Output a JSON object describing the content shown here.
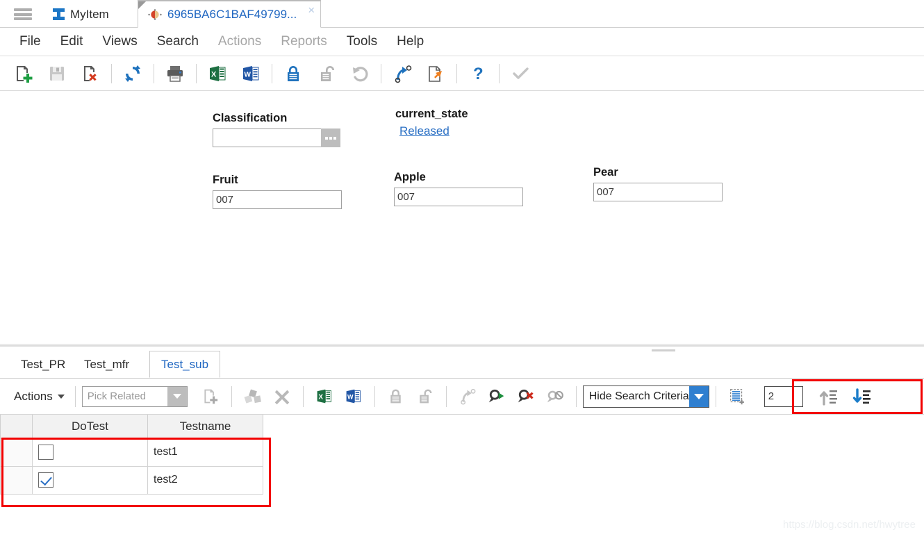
{
  "window": {
    "menu_icon": "hamburger-icon"
  },
  "tabs": [
    {
      "label": "MyItem",
      "icon": "ibeam-icon",
      "active": false
    },
    {
      "label": "6965BA6C1BAF49799...",
      "icon": "sphere-icon",
      "active": true,
      "close": "×"
    }
  ],
  "menubar": [
    {
      "label": "File",
      "disabled": false
    },
    {
      "label": "Edit",
      "disabled": false
    },
    {
      "label": "Views",
      "disabled": false
    },
    {
      "label": "Search",
      "disabled": false
    },
    {
      "label": "Actions",
      "disabled": true
    },
    {
      "label": "Reports",
      "disabled": true
    },
    {
      "label": "Tools",
      "disabled": false
    },
    {
      "label": "Help",
      "disabled": false
    }
  ],
  "toolbar": {
    "buttons": [
      {
        "name": "new-document-icon",
        "enabled": true
      },
      {
        "name": "save-icon",
        "enabled": false
      },
      {
        "name": "delete-document-icon",
        "enabled": true
      },
      {
        "name": "refresh-icon",
        "enabled": true
      },
      {
        "name": "print-icon",
        "enabled": true
      },
      {
        "name": "export-excel-icon",
        "enabled": true
      },
      {
        "name": "export-word-icon",
        "enabled": true
      },
      {
        "name": "lock-icon",
        "enabled": true
      },
      {
        "name": "unlock-icon",
        "enabled": false
      },
      {
        "name": "undo-icon",
        "enabled": false
      },
      {
        "name": "promote-icon",
        "enabled": true
      },
      {
        "name": "copy-to-icon",
        "enabled": true
      },
      {
        "name": "help-icon",
        "enabled": true
      },
      {
        "name": "check-icon",
        "enabled": false
      }
    ]
  },
  "form": {
    "classification": {
      "label": "Classification",
      "value": "",
      "ellipsis": "..."
    },
    "current_state": {
      "label": "current_state",
      "value": "Released"
    },
    "fruit": {
      "label": "Fruit",
      "value": "007"
    },
    "apple": {
      "label": "Apple",
      "value": "007"
    },
    "pear": {
      "label": "Pear",
      "value": "007"
    }
  },
  "subtabs": [
    {
      "label": "Test_PR",
      "active": false
    },
    {
      "label": "Test_mfr",
      "active": false
    },
    {
      "label": "Test_sub",
      "active": true
    }
  ],
  "subtoolbar": {
    "actions_label": "Actions",
    "pick_related_value": "Pick Related",
    "hide_search_label": "Hide Search Criteria",
    "page_size_value": "2",
    "buttons": [
      {
        "name": "add-row-icon",
        "enabled": false
      },
      {
        "name": "structure-browser-icon",
        "enabled": false
      },
      {
        "name": "remove-icon",
        "enabled": false
      },
      {
        "name": "export-excel-icon",
        "enabled": true
      },
      {
        "name": "export-word-icon",
        "enabled": true
      },
      {
        "name": "lock-icon",
        "enabled": false
      },
      {
        "name": "unlock-icon",
        "enabled": false
      },
      {
        "name": "promote-icon",
        "enabled": false
      },
      {
        "name": "run-search-icon",
        "enabled": true
      },
      {
        "name": "clear-search-icon",
        "enabled": true
      },
      {
        "name": "disable-search-icon",
        "enabled": false
      },
      {
        "name": "new-search-icon",
        "enabled": true
      },
      {
        "name": "sort-ascending-icon",
        "enabled": false
      },
      {
        "name": "sort-descending-icon",
        "enabled": true
      }
    ]
  },
  "grid": {
    "columns": [
      "",
      "DoTest",
      "Testname"
    ],
    "rows": [
      {
        "selector": "",
        "dotest_checked": false,
        "testname": "test1"
      },
      {
        "selector": "",
        "dotest_checked": true,
        "testname": "test2"
      }
    ]
  },
  "annotations": {
    "highlight_color": "#f20000",
    "boxes": [
      "page-size-and-sort-controls",
      "grid-rows"
    ]
  },
  "watermark": "https://blog.csdn.net/hwytree"
}
